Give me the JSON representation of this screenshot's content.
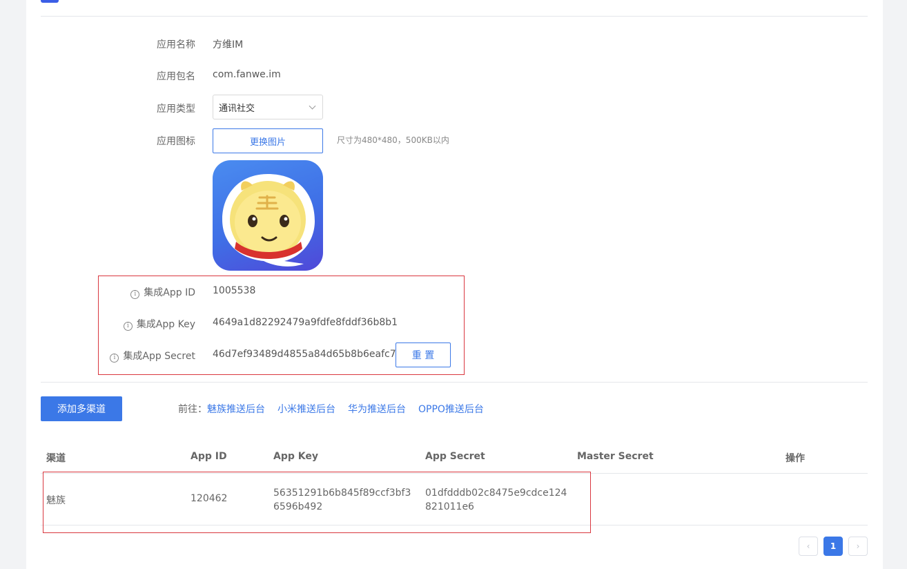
{
  "form": {
    "app_name_label": "应用名称",
    "app_name_value": "方维IM",
    "package_label": "应用包名",
    "package_value": "com.fanwe.im",
    "type_label": "应用类型",
    "type_value": "通讯社交",
    "icon_label": "应用图标",
    "change_image_button": "更换图片",
    "icon_hint": "尺寸为480*480，500KB以内"
  },
  "integration": {
    "info_icon": "info-icon",
    "app_id_label": "集成App ID",
    "app_id_value": "1005538",
    "app_key_label": "集成App Key",
    "app_key_value": "4649a1d82292479a9fdfe8fddf36b8b1",
    "app_secret_label": "集成App Secret",
    "app_secret_value": "46d7ef93489d4855a84d65b8b6eafc7b",
    "reset_button": "重 置"
  },
  "channels": {
    "add_button": "添加多渠道",
    "goto_prefix": "前往：",
    "links": [
      "魅族推送后台",
      "小米推送后台",
      "华为推送后台",
      "OPPO推送后台"
    ],
    "columns": [
      "渠道",
      "App ID",
      "App Key",
      "App Secret",
      "Master Secret",
      "操作"
    ],
    "rows": [
      {
        "channel": "魅族",
        "app_id": "120462",
        "app_key": "56351291b6b845f89ccf3bf36596b492",
        "app_secret": "01dfdddb02c8475e9cdce124821011e6",
        "master_secret": "",
        "actions": ""
      }
    ]
  },
  "pagination": {
    "prev": "‹",
    "current": "1",
    "next": "›"
  },
  "colors": {
    "primary": "#3b78e7",
    "highlight_border": "#d9363e",
    "icon_gradient_top": "#4a8cf0",
    "icon_gradient_bottom": "#5048d8"
  }
}
